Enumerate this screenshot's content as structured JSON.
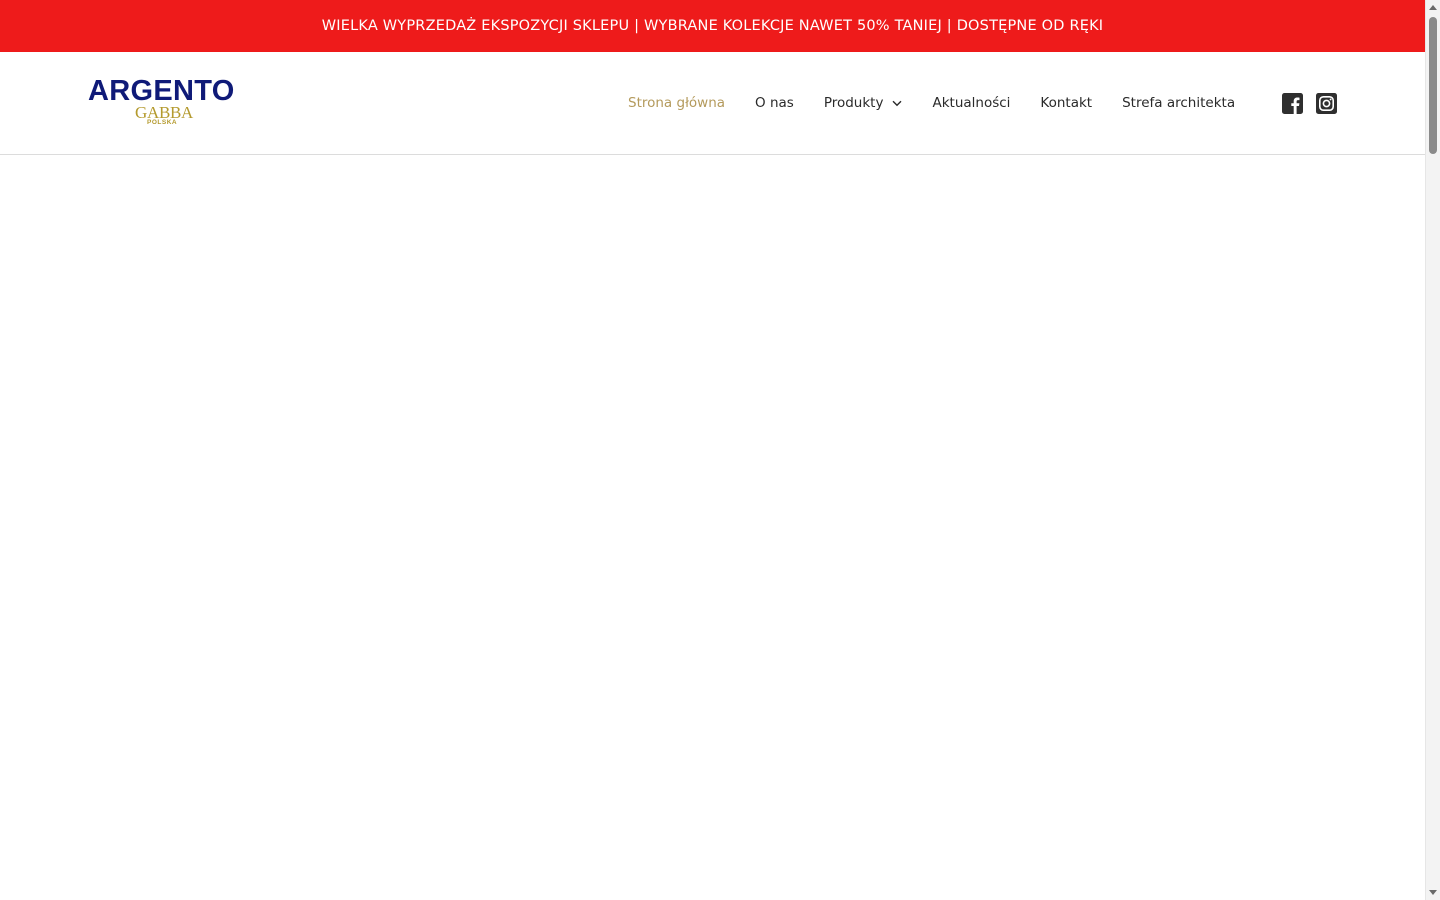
{
  "announcement": {
    "text": "WIELKA WYPRZEDAŻ EKSPOZYCJI SKLEPU | WYBRANE KOLEKCJE NAWET 50% TANIEJ | DOSTĘPNE OD RĘKI"
  },
  "logo": {
    "main": "ARGENTO",
    "sub": "GABBA",
    "country": "POLSKA"
  },
  "nav": {
    "items": [
      {
        "label": "Strona główna",
        "active": true
      },
      {
        "label": "O nas"
      },
      {
        "label": "Produkty",
        "has_dropdown": true
      },
      {
        "label": "Aktualności"
      },
      {
        "label": "Kontakt"
      },
      {
        "label": "Strefa architekta"
      }
    ]
  },
  "socials": {
    "icons": [
      "facebook-icon",
      "instagram-icon"
    ]
  },
  "colors": {
    "announcement_bg": "#ee1b1b",
    "brand_blue": "#0f1a78",
    "brand_gold": "#b49a2e",
    "nav_active": "#b49a5c"
  }
}
